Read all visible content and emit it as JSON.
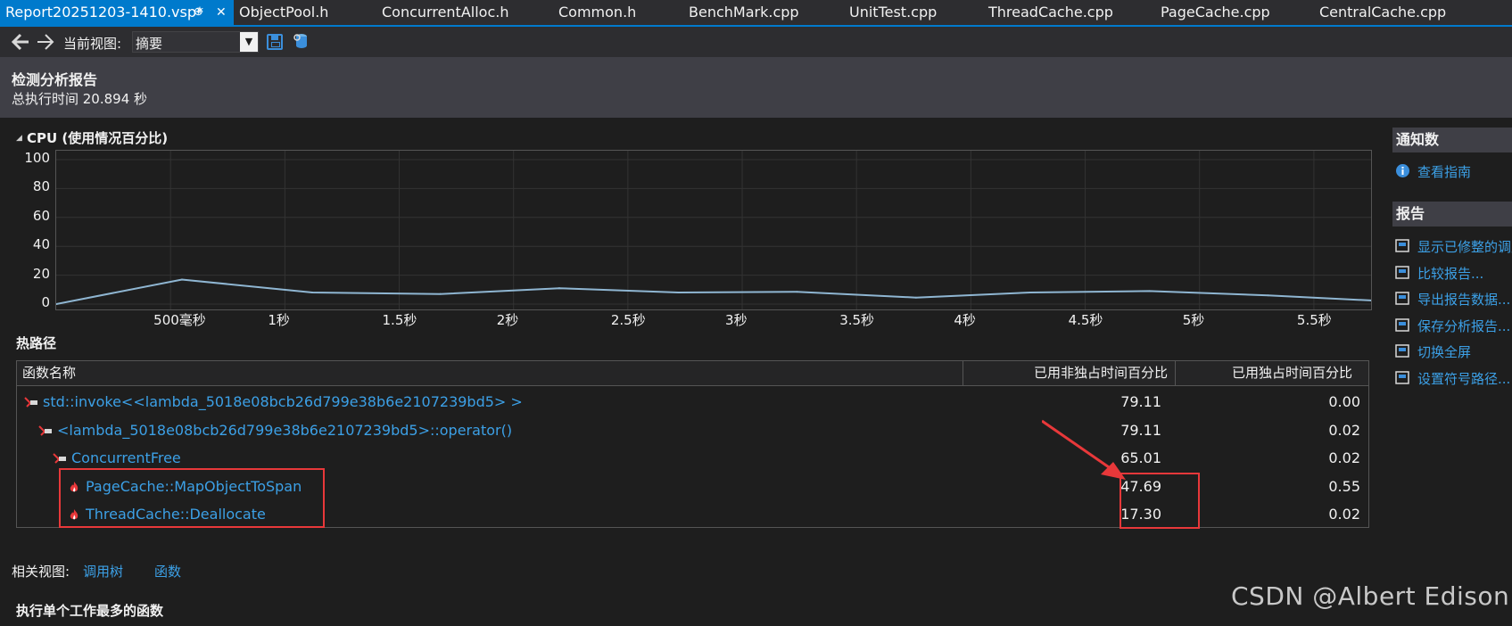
{
  "tabs": [
    {
      "label": "Report20251203-1410.vsp*",
      "active": true
    },
    {
      "label": "ObjectPool.h"
    },
    {
      "label": "ConcurrentAlloc.h"
    },
    {
      "label": "Common.h"
    },
    {
      "label": "BenchMark.cpp"
    },
    {
      "label": "UnitTest.cpp"
    },
    {
      "label": "ThreadCache.cpp"
    },
    {
      "label": "PageCache.cpp"
    },
    {
      "label": "CentralCache.cpp"
    }
  ],
  "tab_pin": "⊕",
  "tab_close": "✕",
  "toolbar": {
    "view_label": "当前视图:",
    "view_value": "摘要"
  },
  "header": {
    "title": "检测分析报告",
    "subtitle": "总执行时间 20.894 秒"
  },
  "cpu_section": {
    "title": "CPU (使用情况百分比)",
    "toggle": "◢"
  },
  "chart_data": {
    "type": "line",
    "title": "CPU (使用情况百分比)",
    "xlabel": "",
    "ylabel": "",
    "ylim": [
      0,
      100
    ],
    "y_ticks": [
      "100",
      "80",
      "60",
      "40",
      "20",
      "0"
    ],
    "x_ticks": [
      "500毫秒",
      "1秒",
      "1.5秒",
      "2秒",
      "2.5秒",
      "3秒",
      "3.5秒",
      "4秒",
      "4.5秒",
      "5秒",
      "5.5秒"
    ],
    "x_tick_values": [
      0.5,
      1.0,
      1.5,
      2.0,
      2.5,
      3.0,
      3.5,
      4.0,
      4.5,
      5.0,
      5.5
    ],
    "x_range": [
      0,
      5.75
    ],
    "x": [
      0.0,
      0.55,
      1.12,
      1.68,
      2.2,
      2.72,
      3.24,
      3.76,
      4.26,
      4.78,
      5.3,
      5.75
    ],
    "values": [
      0,
      17,
      8,
      7,
      11,
      8,
      8.5,
      4.5,
      8,
      9,
      6,
      2.5
    ],
    "grid": true,
    "color": "#8fb6d2"
  },
  "hotpath": {
    "title": "热路径",
    "columns": [
      "函数名称",
      "已用非独占时间百分比",
      "已用独占时间百分比"
    ],
    "rows": [
      {
        "name": "std::invoke<<lambda_5018e08bcb26d799e38b6e2107239bd5> >",
        "inclusive": "79.11",
        "exclusive": "0.00",
        "icon": "call-path-icon"
      },
      {
        "name": "<lambda_5018e08bcb26d799e38b6e2107239bd5>::operator()",
        "inclusive": "79.11",
        "exclusive": "0.02",
        "icon": "call-path-icon"
      },
      {
        "name": "ConcurrentFree",
        "inclusive": "65.01",
        "exclusive": "0.02",
        "icon": "call-path-icon"
      },
      {
        "name": "PageCache::MapObjectToSpan",
        "inclusive": "47.69",
        "exclusive": "0.55",
        "icon": "flame-icon"
      },
      {
        "name": "ThreadCache::Deallocate",
        "inclusive": "17.30",
        "exclusive": "0.02",
        "icon": "flame-icon"
      }
    ]
  },
  "related": {
    "label": "相关视图:",
    "links": [
      "调用树",
      "函数"
    ]
  },
  "bottom_section": {
    "title": "执行单个工作最多的函数"
  },
  "right_panel": {
    "notifications_title": "通知数",
    "notifications_items": [
      "查看指南"
    ],
    "report_title": "报告",
    "report_items": [
      "显示已修整的调用",
      "比较报告...",
      "导出报告数据...",
      "保存分析报告...",
      "切换全屏",
      "设置符号路径..."
    ]
  },
  "watermark": "CSDN @Albert Edison"
}
